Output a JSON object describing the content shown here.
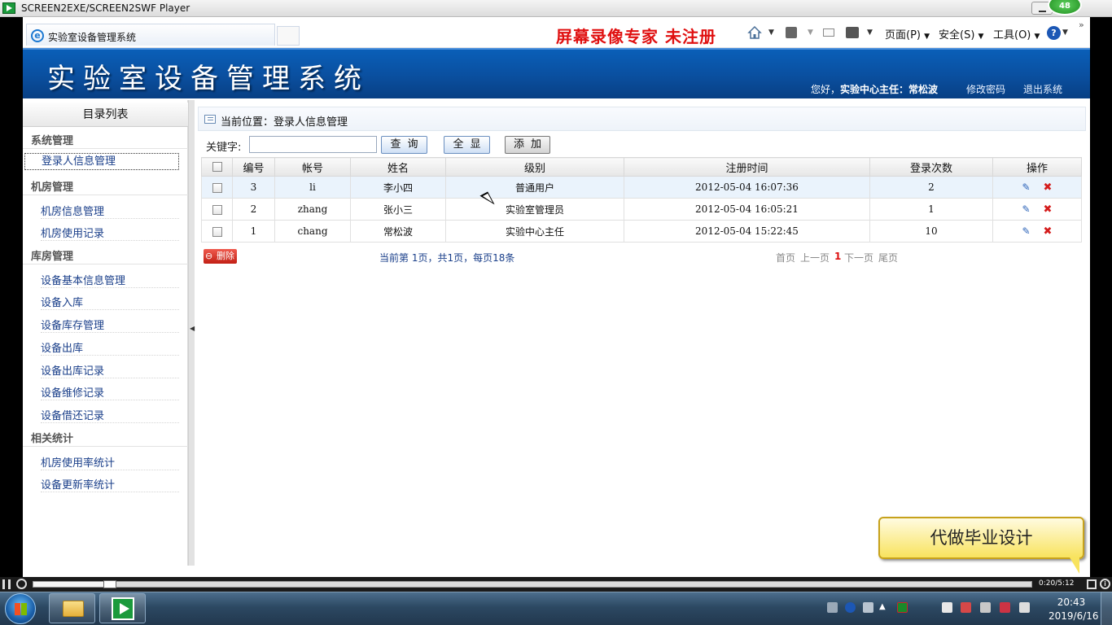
{
  "player": {
    "title": "SCREEN2EXE/SCREEN2SWF Player",
    "badge": "48",
    "time": "0:20/5:12",
    "progress_fraction": 0.07
  },
  "browser": {
    "tab_title": "实验室设备管理系统",
    "watermark": "屏幕录像专家  未注册",
    "menu_page": "页面(P)",
    "menu_safety": "安全(S)",
    "menu_tools": "工具(O)",
    "help_glyph": "?"
  },
  "app": {
    "logo": "实验室设备管理系统",
    "greeting": "您好，",
    "user": "实验中心主任：常松波",
    "change_password": "修改密码",
    "logout": "退出系统"
  },
  "sidebar": {
    "title": "目录列表",
    "groups": [
      {
        "label": "系统管理",
        "items": [
          "登录人信息管理"
        ]
      },
      {
        "label": "机房管理",
        "items": [
          "机房信息管理",
          "机房使用记录"
        ]
      },
      {
        "label": "库房管理",
        "items": [
          "设备基本信息管理",
          "设备入库",
          "设备库存管理",
          "设备出库",
          "设备出库记录",
          "设备维修记录",
          "设备借还记录"
        ]
      },
      {
        "label": "相关统计",
        "items": [
          "机房使用率统计",
          "设备更新率统计"
        ]
      }
    ]
  },
  "main": {
    "breadcrumb": "当前位置：登录人信息管理",
    "keyword_label": "关键字:",
    "keyword_value": "",
    "search_button": "查询",
    "show_all_button": "全显",
    "add_button": "添加",
    "table": {
      "headers": [
        "编号",
        "帐号",
        "姓名",
        "级别",
        "注册时间",
        "登录次数",
        "操作"
      ],
      "rows": [
        {
          "id": "3",
          "account": "li",
          "name": "李小四",
          "level": "普通用户",
          "registered": "2012-05-04 16:07:36",
          "logins": "2"
        },
        {
          "id": "2",
          "account": "zhang",
          "name": "张小三",
          "level": "实验室管理员",
          "registered": "2012-05-04 16:05:21",
          "logins": "1"
        },
        {
          "id": "1",
          "account": "chang",
          "name": "常松波",
          "level": "实验中心主任",
          "registered": "2012-05-04 15:22:45",
          "logins": "10"
        }
      ]
    },
    "delete_button": "删除",
    "page_info": "当前第 1页，共1页，每页18条",
    "pager": {
      "first": "首页",
      "prev": "上一页",
      "current": "1",
      "next": "下一页",
      "last": "尾页"
    }
  },
  "promo": "代做毕业设计",
  "taskbar": {
    "time": "20:43",
    "date": "2019/6/16"
  }
}
